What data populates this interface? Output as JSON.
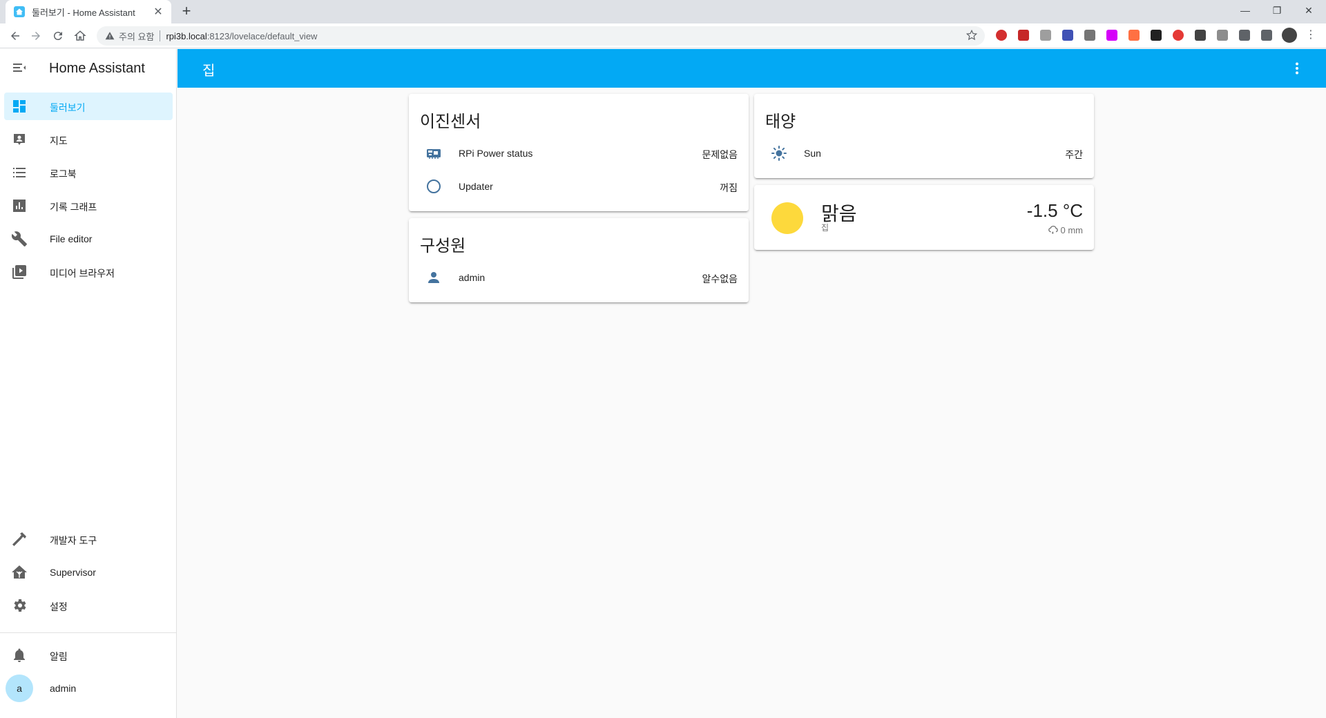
{
  "browser": {
    "tab_title": "둘러보기 - Home Assistant",
    "new_tab_glyph": "+",
    "close_glyph": "✕",
    "security_warning": "주의 요함",
    "url_host": "rpi3b.local",
    "url_rest": ":8123/lovelace/default_view",
    "win_minimize": "—",
    "win_restore": "❐",
    "win_close": "✕"
  },
  "sidebar": {
    "title": "Home Assistant",
    "items": [
      {
        "label": "둘러보기",
        "icon": "dashboard-icon",
        "active": true
      },
      {
        "label": "지도",
        "icon": "map-account-icon",
        "active": false
      },
      {
        "label": "로그북",
        "icon": "list-icon",
        "active": false
      },
      {
        "label": "기록 그래프",
        "icon": "chart-box-icon",
        "active": false
      },
      {
        "label": "File editor",
        "icon": "wrench-icon",
        "active": false
      },
      {
        "label": "미디어 브라우저",
        "icon": "media-play-box-icon",
        "active": false
      }
    ],
    "bottom_items": [
      {
        "label": "개발자 도구",
        "icon": "hammer-icon"
      },
      {
        "label": "Supervisor",
        "icon": "home-assistant-icon"
      },
      {
        "label": "설정",
        "icon": "gear-icon"
      }
    ],
    "notifications_label": "알림",
    "user": {
      "initial": "a",
      "name": "admin"
    }
  },
  "appbar": {
    "title": "집"
  },
  "cards": {
    "binary_sensor": {
      "title": "이진센서",
      "rows": [
        {
          "name": "RPi Power status",
          "state": "문제없음",
          "icon": "raspberry-pi-icon"
        },
        {
          "name": "Updater",
          "state": "꺼짐",
          "icon": "circle-outline-icon"
        }
      ]
    },
    "person": {
      "title": "구성원",
      "rows": [
        {
          "name": "admin",
          "state": "알수없음",
          "icon": "account-icon"
        }
      ]
    },
    "sun": {
      "title": "태양",
      "rows": [
        {
          "name": "Sun",
          "state": "주간",
          "icon": "white-balance-sunny-icon"
        }
      ]
    },
    "weather": {
      "condition": "맑음",
      "location": "집",
      "temperature": "-1.5 °C",
      "precipitation": "0 mm"
    }
  },
  "colors": {
    "primary": "#03a9f4",
    "state_icon": "#44739e",
    "sun_disc": "#fdd93c"
  }
}
